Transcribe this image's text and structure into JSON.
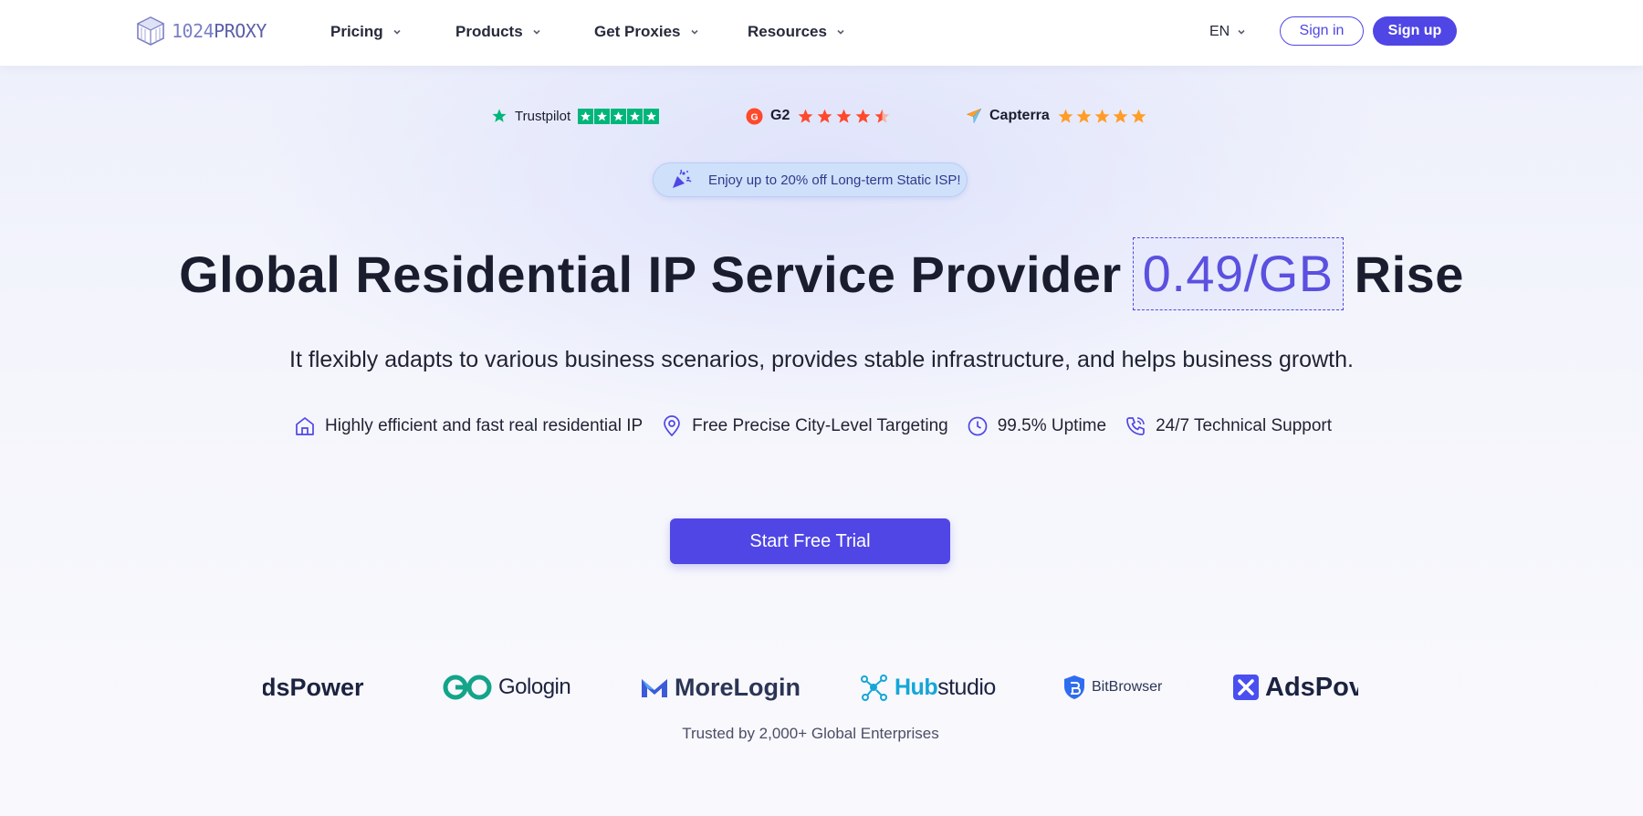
{
  "brand": {
    "logo_number": "1024",
    "logo_word": "PROXY"
  },
  "nav": {
    "items": [
      {
        "label": "Pricing"
      },
      {
        "label": "Products"
      },
      {
        "label": "Get Proxies"
      },
      {
        "label": "Resources"
      }
    ],
    "language": "EN",
    "sign_in": "Sign in",
    "sign_up": "Sign up"
  },
  "ratings": [
    {
      "name": "Trustpilot",
      "stars": 5,
      "color": "#00b67a"
    },
    {
      "name": "G2",
      "stars": 4.5,
      "color": "#ff492c"
    },
    {
      "name": "Capterra",
      "stars": 5,
      "color": "#ff9d28"
    }
  ],
  "promo": {
    "text": "Enjoy up to 20% off Long-term Static ISP!"
  },
  "hero": {
    "headline_start": "Global Residential IP Service Provider",
    "headline_highlight": "0.49/GB",
    "headline_end": "Rise",
    "subtitle": "It flexibly adapts to various business scenarios, provides stable infrastructure, and helps business growth.",
    "features": [
      {
        "icon": "home-icon",
        "label": "Highly efficient and fast real residential IP"
      },
      {
        "icon": "location-pin-icon",
        "label": "Free Precise City-Level Targeting"
      },
      {
        "icon": "clock-icon",
        "label": "99.5% Uptime"
      },
      {
        "icon": "phone-icon",
        "label": "24/7 Technical Support"
      }
    ],
    "cta": "Start Free Trial"
  },
  "partners": {
    "logos": [
      {
        "name_a": "Ads",
        "name_b": "Power",
        "visible": "dsPower"
      },
      {
        "name": "Gologin"
      },
      {
        "name": "MoreLogin"
      },
      {
        "name_a": "Hub",
        "name_b": "studio"
      },
      {
        "name": "BitBrowser"
      },
      {
        "visible": "AdsPov"
      }
    ],
    "caption": "Trusted by 2,000+ Global Enterprises"
  },
  "colors": {
    "accent": "#4f46e5",
    "text": "#1a1d2e",
    "promo_bg": "#cfe0fb"
  }
}
